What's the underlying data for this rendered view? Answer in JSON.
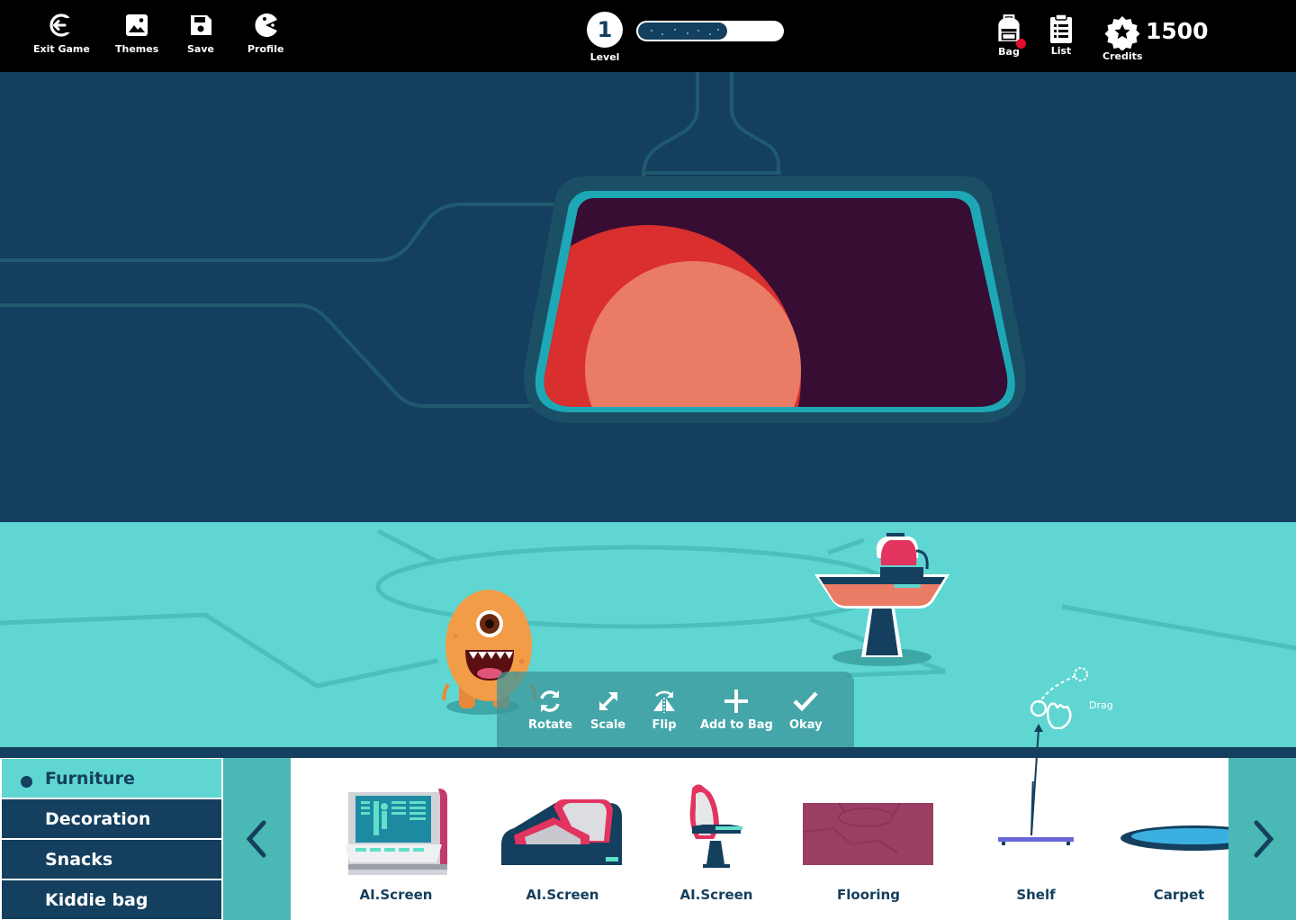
{
  "topbar": {
    "exit_label": "Exit Game",
    "themes_label": "Themes",
    "save_label": "Save",
    "profile_label": "Profile",
    "level_value": "1",
    "level_label": "Level",
    "level_progress": 0.62,
    "bag_label": "Bag",
    "list_label": "List",
    "credits_label": "Credits",
    "credits_value": "1500"
  },
  "edit_toolbar": {
    "rotate_label": "Rotate",
    "scale_label": "Scale",
    "flip_label": "Flip",
    "add_to_bag_label": "Add to Bag",
    "okay_label": "Okay"
  },
  "drag_hint": {
    "label": "Drag"
  },
  "categories": [
    {
      "label": "Furniture",
      "active": true
    },
    {
      "label": "Decoration",
      "active": false
    },
    {
      "label": "Snacks",
      "active": false
    },
    {
      "label": "Kiddie bag",
      "active": false
    }
  ],
  "items": [
    {
      "label": "AI.Screen",
      "icon": "ai-screen-console-icon"
    },
    {
      "label": "AI.Screen",
      "icon": "ai-screen-couch-icon"
    },
    {
      "label": "AI.Screen",
      "icon": "ai-screen-chair-icon"
    },
    {
      "label": "Flooring",
      "icon": "flooring-icon"
    },
    {
      "label": "Shelf",
      "icon": "shelf-icon"
    },
    {
      "label": "Carpet",
      "icon": "carpet-icon"
    }
  ],
  "colors": {
    "navy": "#143f5e",
    "teal": "#5fd6d2",
    "teal_dark": "#4ab8b4",
    "window_frame": "#1ea8b6",
    "space": "#380d33",
    "planet": "#ea7b64",
    "planet_shadow": "#d92f2f",
    "monster": "#f29c47",
    "accent_pink": "#e2345f",
    "notification": "#e0102a"
  }
}
